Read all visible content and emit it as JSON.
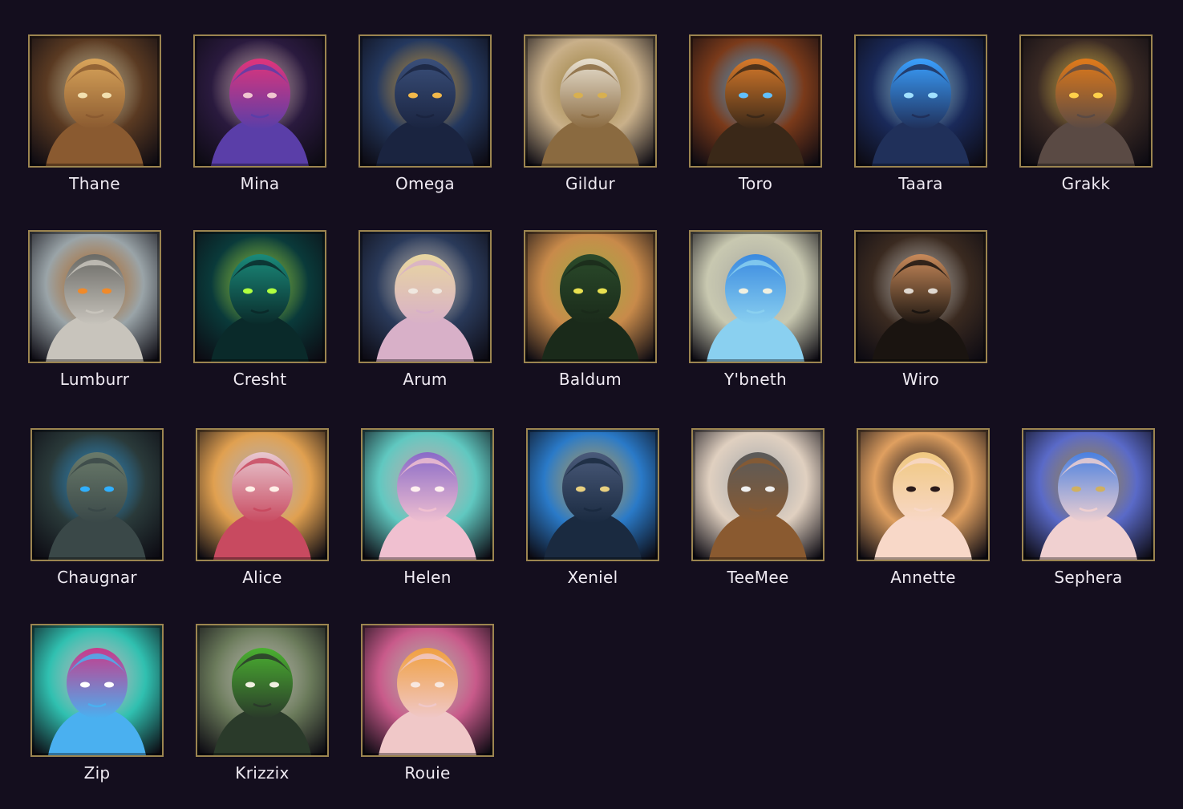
{
  "heroes": [
    {
      "name": "Thane",
      "icon": "thane-portrait-icon",
      "bg": "#5a3a22",
      "c1": "#d9a45a",
      "c2": "#8a5a30",
      "c3": "#f2e0b0"
    },
    {
      "name": "Mina",
      "icon": "mina-portrait-icon",
      "bg": "#2a1a3e",
      "c1": "#e0347a",
      "c2": "#5a3ea8",
      "c3": "#f0c6d0"
    },
    {
      "name": "Omega",
      "icon": "omega-portrait-icon",
      "bg": "#24385e",
      "c1": "#3a4f7a",
      "c2": "#1a2440",
      "c3": "#f2b84a"
    },
    {
      "name": "Gildur",
      "icon": "gildur-portrait-icon",
      "bg": "#c9b08a",
      "c1": "#e8e0d0",
      "c2": "#8a6a40",
      "c3": "#d8b050"
    },
    {
      "name": "Toro",
      "icon": "toro-portrait-icon",
      "bg": "#7a3a1a",
      "c1": "#d87a2a",
      "c2": "#3a2818",
      "c3": "#60c0ff"
    },
    {
      "name": "Taara",
      "icon": "taara-portrait-icon",
      "bg": "#1a2a5a",
      "c1": "#3aa0ff",
      "c2": "#20305a",
      "c3": "#a0e0ff"
    },
    {
      "name": "Grakk",
      "icon": "grakk-portrait-icon",
      "bg": "#3a2a24",
      "c1": "#e07a1a",
      "c2": "#5a4a44",
      "c3": "#ffd04a"
    },
    {
      "name": "Lumburr",
      "icon": "lumburr-portrait-icon",
      "bg": "#9aa4a8",
      "c1": "#6a6a66",
      "c2": "#c8c4bc",
      "c3": "#f08a2a"
    },
    {
      "name": "Cresht",
      "icon": "cresht-portrait-icon",
      "bg": "#0a3a3a",
      "c1": "#1a8a7a",
      "c2": "#0a2a2a",
      "c3": "#b0ff40"
    },
    {
      "name": "Arum",
      "icon": "arum-portrait-icon",
      "bg": "#2a3a5a",
      "c1": "#e8d6a0",
      "c2": "#d8b0c8",
      "c3": "#f0e8e0"
    },
    {
      "name": "Baldum",
      "icon": "baldum-portrait-icon",
      "bg": "#c88a4a",
      "c1": "#2a4a2a",
      "c2": "#1a2a1a",
      "c3": "#e8e050"
    },
    {
      "name": "Y'bneth",
      "icon": "ybneth-portrait-icon",
      "bg": "#c8c8b0",
      "c1": "#3a8ae0",
      "c2": "#8ad0f0",
      "c3": "#f0f0e0"
    },
    {
      "name": "Wiro",
      "icon": "wiro-portrait-icon",
      "bg": "#3a2a20",
      "c1": "#c88a5a",
      "c2": "#1a1410",
      "c3": "#e0d8d0"
    },
    {
      "name": "Chaugnar",
      "icon": "chaugnar-portrait-icon",
      "bg": "#2a3a3a",
      "c1": "#6a7a6a",
      "c2": "#3a4848",
      "c3": "#30b0ff"
    },
    {
      "name": "Alice",
      "icon": "alice-portrait-icon",
      "bg": "#e0a050",
      "c1": "#e8c8d0",
      "c2": "#c84a60",
      "c3": "#fff0e8"
    },
    {
      "name": "Helen",
      "icon": "helen-portrait-icon",
      "bg": "#60c8c0",
      "c1": "#8a6ac8",
      "c2": "#f0c0d0",
      "c3": "#fff0f0"
    },
    {
      "name": "Xeniel",
      "icon": "xeniel-portrait-icon",
      "bg": "#2a7ac8",
      "c1": "#4a5a7a",
      "c2": "#1a2a40",
      "c3": "#e8d080"
    },
    {
      "name": "TeeMee",
      "icon": "teemee-portrait-icon",
      "bg": "#e0d0c0",
      "c1": "#5a5a5a",
      "c2": "#8a5a30",
      "c3": "#f0f0f0"
    },
    {
      "name": "Annette",
      "icon": "annette-portrait-icon",
      "bg": "#e0a060",
      "c1": "#f0c880",
      "c2": "#f8d8c8",
      "c3": "#2a1a1a"
    },
    {
      "name": "Sephera",
      "icon": "sephera-portrait-icon",
      "bg": "#5a6ac8",
      "c1": "#4a80e0",
      "c2": "#f0d0d0",
      "c3": "#d0b060"
    },
    {
      "name": "Zip",
      "icon": "zip-portrait-icon",
      "bg": "#30c0b0",
      "c1": "#c83a8a",
      "c2": "#4ab0f0",
      "c3": "#ffffff"
    },
    {
      "name": "Krizzix",
      "icon": "krizzix-portrait-icon",
      "bg": "#6a7a5a",
      "c1": "#4ab030",
      "c2": "#2a3a2a",
      "c3": "#f0f0e0"
    },
    {
      "name": "Rouie",
      "icon": "rouie-portrait-icon",
      "bg": "#c85a8a",
      "c1": "#f0a040",
      "c2": "#f0c8c8",
      "c3": "#f8e8e0"
    }
  ]
}
